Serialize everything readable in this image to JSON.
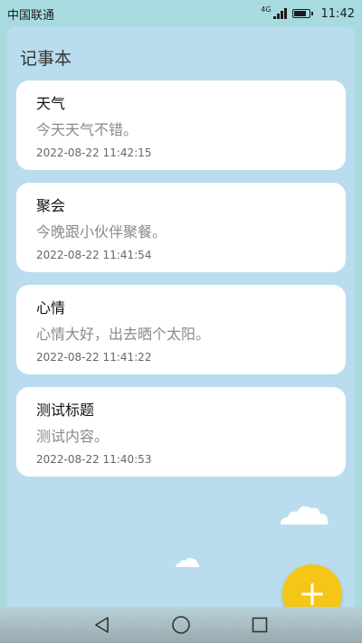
{
  "status_bar": {
    "carrier": "中国联通",
    "network": "4G",
    "signal_level": 4,
    "battery_level": 0.85,
    "time": "11:42"
  },
  "app": {
    "title": "记事本"
  },
  "notes": [
    {
      "title": "天气",
      "content": "今天天气不错。",
      "time": "2022-08-22 11:42:15"
    },
    {
      "title": "聚会",
      "content": "今晚跟小伙伴聚餐。",
      "time": "2022-08-22 11:41:54"
    },
    {
      "title": "心情",
      "content": "心情大好，出去晒个太阳。",
      "time": "2022-08-22 11:41:22"
    },
    {
      "title": "测试标题",
      "content": "测试内容。",
      "time": "2022-08-22 11:40:53"
    }
  ],
  "fab": {
    "icon": "plus-icon",
    "color": "#f5c518"
  },
  "nav_bar": {
    "buttons": [
      "back-triangle-icon",
      "home-circle-icon",
      "recents-square-icon"
    ]
  },
  "colors": {
    "background": "#a8dbe0",
    "panel": "#b9ddee",
    "card": "#ffffff"
  }
}
